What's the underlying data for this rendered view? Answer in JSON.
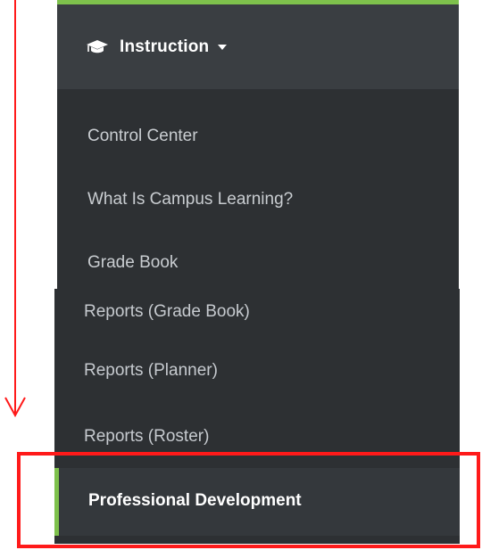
{
  "menu": {
    "header": {
      "icon": "graduation-cap-icon",
      "title": "Instruction",
      "caret": "caret-down-icon"
    },
    "items": [
      {
        "label": "Control Center"
      },
      {
        "label": "What Is Campus Learning?"
      },
      {
        "label": "Grade Book"
      },
      {
        "label": "Reports (Grade Book)"
      },
      {
        "label": "Reports (Planner)"
      },
      {
        "label": "Reports (Roster)"
      },
      {
        "label": "Professional Development",
        "active": true
      }
    ]
  },
  "colors": {
    "panel_background": "#2d3033",
    "header_background": "#3a3e42",
    "accent_green": "#7ec14c",
    "annotation_red": "#ff1a1a"
  }
}
